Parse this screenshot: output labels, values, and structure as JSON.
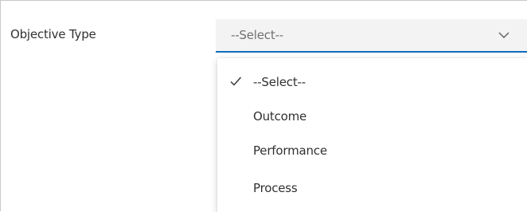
{
  "form": {
    "field_label": "Objective Type",
    "select": {
      "value": "--Select--",
      "expanded": true,
      "options": [
        {
          "label": "--Select--",
          "selected": true
        },
        {
          "label": "Outcome",
          "selected": false
        },
        {
          "label": "Performance",
          "selected": false
        },
        {
          "label": "Process",
          "selected": false
        }
      ]
    }
  },
  "colors": {
    "accent_underline": "#106ebe",
    "select_background": "#f3f3f3",
    "placeholder_text": "#707070",
    "text": "#323130"
  },
  "icons": {
    "dropdown_indicator": "chevron-down-icon",
    "selected_marker": "checkmark-icon"
  }
}
